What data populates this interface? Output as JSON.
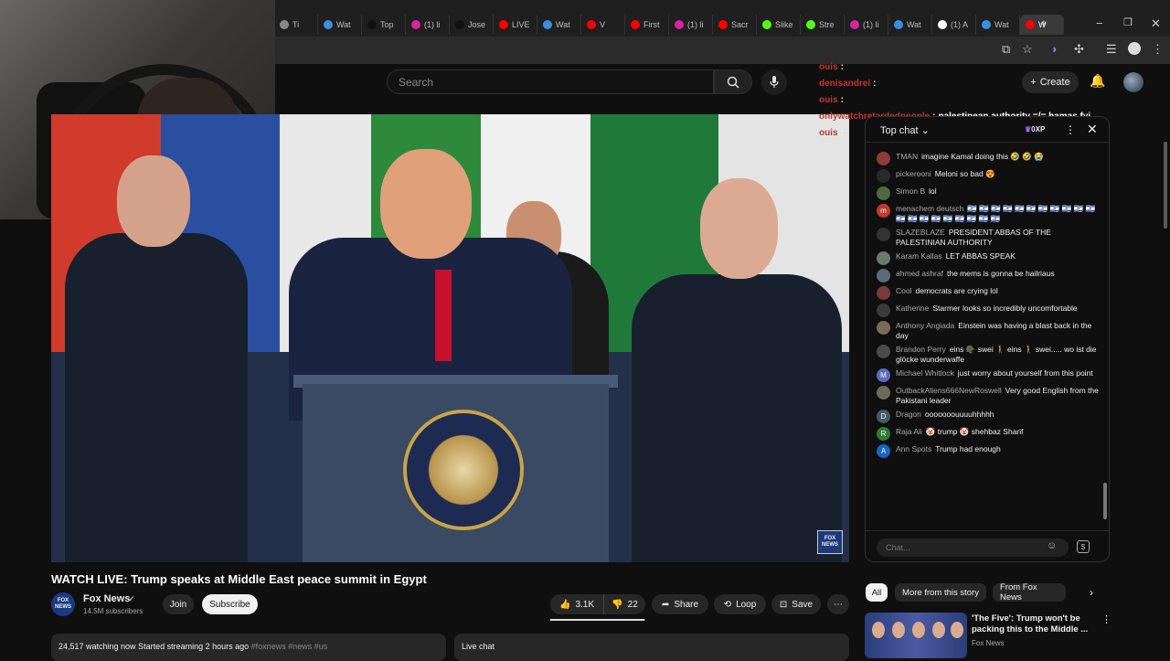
{
  "browser": {
    "tabs": [
      {
        "label": "Ti",
        "color": "#888888"
      },
      {
        "label": "Wat",
        "color": "#3c8dde"
      },
      {
        "label": "Top",
        "color": "#111111"
      },
      {
        "label": "(1) li",
        "color": "#d6249f"
      },
      {
        "label": "Jose",
        "color": "#111111"
      },
      {
        "label": "LIVE",
        "color": "#ff0000"
      },
      {
        "label": "Wat",
        "color": "#3c8dde"
      },
      {
        "label": "V",
        "color": "#ff0000"
      },
      {
        "label": "First",
        "color": "#ff0000"
      },
      {
        "label": "(1) li",
        "color": "#d6249f"
      },
      {
        "label": "Sacr",
        "color": "#ff0000"
      },
      {
        "label": "Slike",
        "color": "#53fc18"
      },
      {
        "label": "Stre",
        "color": "#53fc18"
      },
      {
        "label": "(1) li",
        "color": "#d6249f"
      },
      {
        "label": "Wat",
        "color": "#3c8dde"
      },
      {
        "label": "(1) A",
        "color": "#ffffff"
      },
      {
        "label": "Wat",
        "color": "#3c8dde"
      },
      {
        "label": "W",
        "color": "#ff0000"
      }
    ],
    "active_tab": 17,
    "new_tab": "+",
    "minimize": "−",
    "restore": "❐",
    "close": "✕"
  },
  "header": {
    "search_placeholder": "Search",
    "create_label": "Create"
  },
  "overlay_chat": [
    {
      "user": "ouis",
      "msg": ""
    },
    {
      "user": "denisandrei",
      "msg": ""
    },
    {
      "user": "ouis",
      "msg": ""
    },
    {
      "user": "onlywatchretardedpeople",
      "msg": "palestinean authority =/= hamas fyi"
    },
    {
      "user": "ouis",
      "msg": ""
    }
  ],
  "video": {
    "title": "WATCH LIVE: Trump speaks at Middle East peace summit in Egypt",
    "bug_text": "FOX NEWS"
  },
  "channel": {
    "avatar_text": "FOX NEWS",
    "name": "Fox News",
    "subs": "14.5M subscribers",
    "join": "Join",
    "subscribe": "Subscribe"
  },
  "actions": {
    "likes": "3.1K",
    "dislikes": "22",
    "share": "Share",
    "loop": "Loop",
    "save": "Save",
    "like_ratio": 0.99
  },
  "info": {
    "stats": "24,517 watching now  Started streaming 2 hours ago",
    "tags": "#foxnews #news #us",
    "live_chat": "Live chat"
  },
  "chat": {
    "title": "Top chat",
    "points": "0XP",
    "input_placeholder": "Chat...",
    "messages": [
      {
        "user": "TMAN",
        "text": "imagine Kamal doing this 🤣 🤣 😭",
        "color": "#8e3b3b",
        "initial": ""
      },
      {
        "user": "pickerooni",
        "text": "Meloni so bad 😍",
        "color": "#2a2a2a",
        "initial": ""
      },
      {
        "user": "Simon B",
        "text": "lol",
        "color": "#4e6a3c",
        "initial": ""
      },
      {
        "user": "menachem deutsch",
        "text": "🇮🇱 🇮🇱 🇮🇱 🇮🇱 🇮🇱 🇮🇱 🇮🇱 🇮🇱 🇮🇱 🇮🇱 🇮🇱 🇮🇱 🇮🇱 🇮🇱 🇮🇱 🇮🇱 🇮🇱 🇮🇱 🇮🇱 🇮🇱",
        "color": "#c0392b",
        "initial": "m"
      },
      {
        "user": "SLAZEBLAZE",
        "text": "PRESIDENT ABBAS OF THE PALESTINIAN AUTHORITY",
        "color": "#333333",
        "initial": ""
      },
      {
        "user": "Karam Kallas",
        "text": "LET ABBAS SPEAK",
        "color": "#6b7a6b",
        "initial": ""
      },
      {
        "user": "ahmed ashraf",
        "text": "the mems is gonna be hailriaus",
        "color": "#5a6b7a",
        "initial": ""
      },
      {
        "user": "Cool",
        "text": "democrats are crying lol",
        "color": "#7a3a3a",
        "initial": ""
      },
      {
        "user": "Katherine",
        "text": "Starmer looks so incredibly uncomfortable",
        "color": "#3a3a3a",
        "initial": ""
      },
      {
        "user": "Anthony Angiada",
        "text": "Einstein was having a blast back in the day",
        "color": "#7a6a5a",
        "initial": ""
      },
      {
        "user": "Brandon Perry",
        "text": "eins 🪖 swei 🚶 eins 🚶 swei..... wo ist die glöcke wunderwaffe",
        "color": "#4a4a4a",
        "initial": ""
      },
      {
        "user": "Michael Whitlock",
        "text": "just worry about yourself from this point",
        "color": "#5c6bc0",
        "initial": "M"
      },
      {
        "user": "OutbackAliens666NewRoswell",
        "text": "Very good English from the Pakistani leader",
        "color": "#6a6a5a",
        "initial": ""
      },
      {
        "user": "Dragon",
        "text": "ooooooouuuuhhhhh",
        "color": "#455a64",
        "initial": "D"
      },
      {
        "user": "Raja Ali",
        "text": "🤡 trump 🤡 shehbaz Sharif",
        "color": "#2e7d32",
        "initial": "R"
      },
      {
        "user": "Ann Spots",
        "text": "Trump had enough",
        "color": "#1565c0",
        "initial": "A"
      }
    ]
  },
  "chips": [
    "All",
    "More from this story",
    "From Fox News"
  ],
  "recommendation": {
    "title": "'The Five': Trump won't be packing this to the Middle ...",
    "channel": "Fox News"
  }
}
